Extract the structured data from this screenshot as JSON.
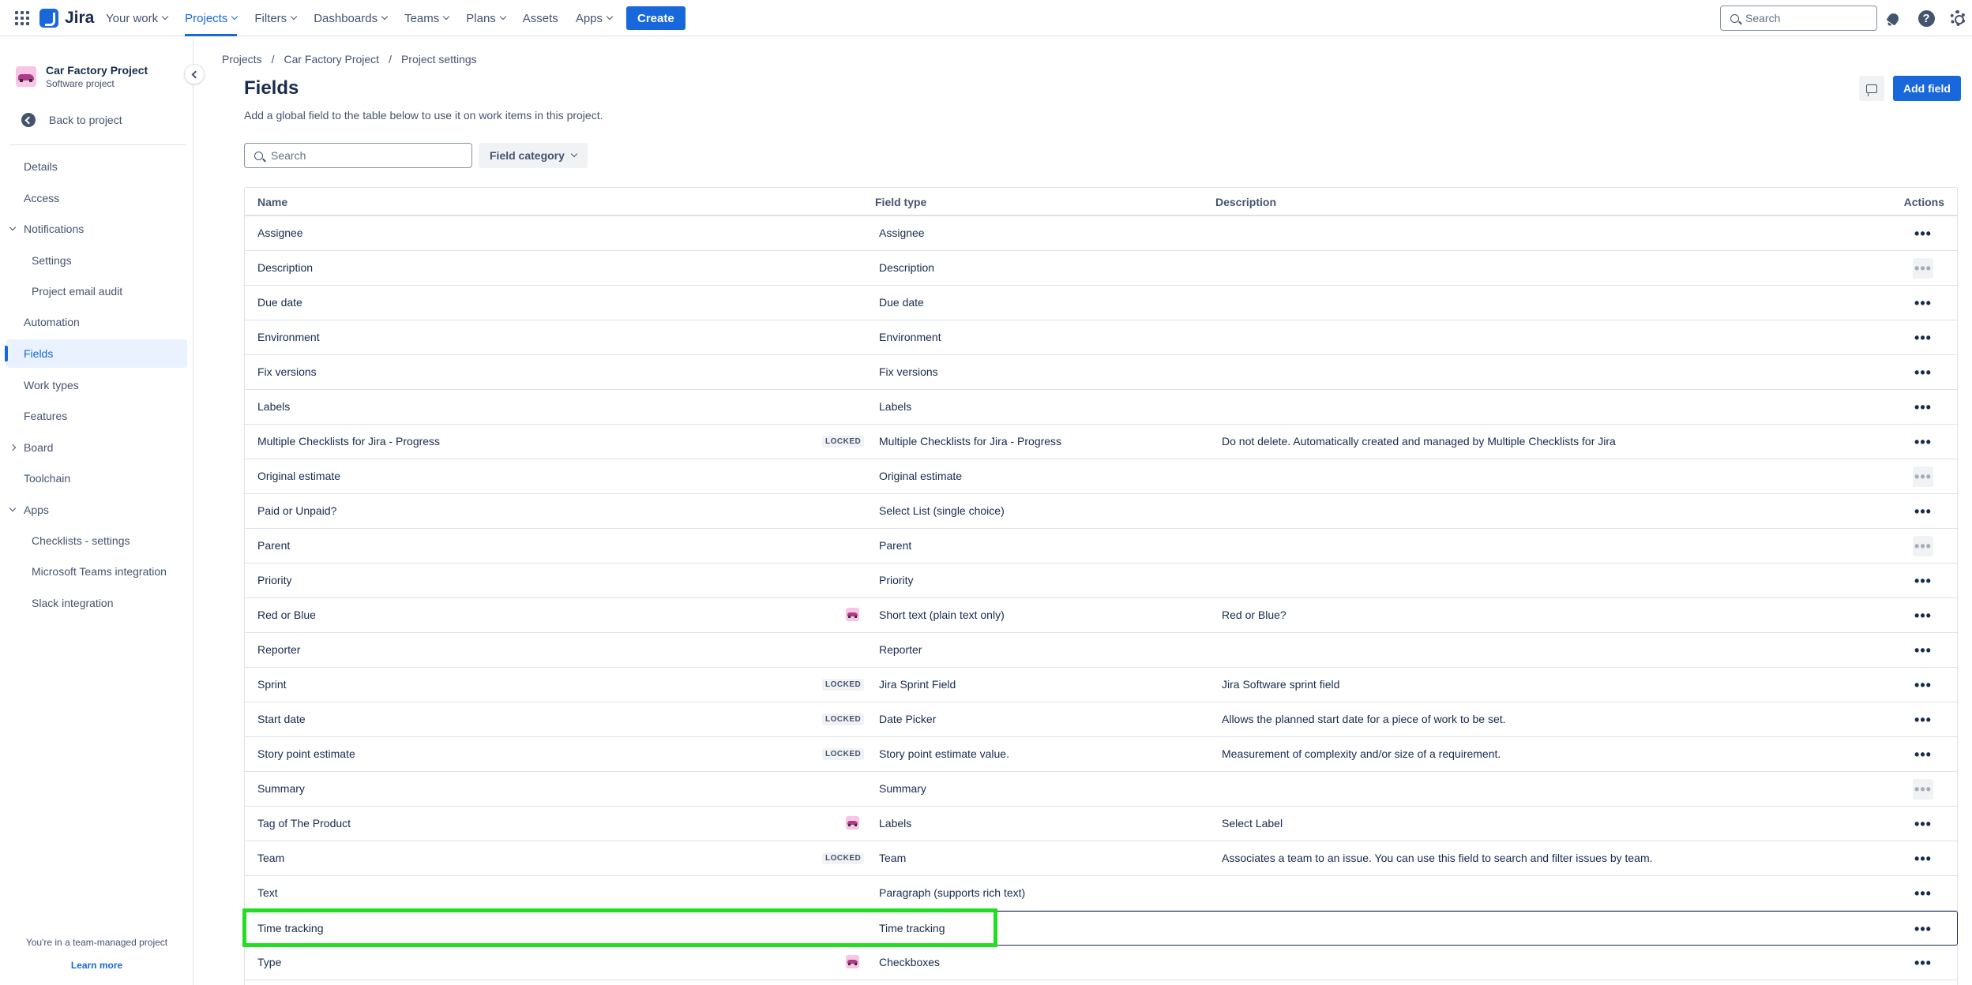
{
  "topnav": {
    "app_name": "Jira",
    "items": [
      {
        "label": "Your work",
        "chevron": true,
        "active": false
      },
      {
        "label": "Projects",
        "chevron": true,
        "active": true
      },
      {
        "label": "Filters",
        "chevron": true,
        "active": false
      },
      {
        "label": "Dashboards",
        "chevron": true,
        "active": false
      },
      {
        "label": "Teams",
        "chevron": true,
        "active": false
      },
      {
        "label": "Plans",
        "chevron": true,
        "active": false
      },
      {
        "label": "Assets",
        "chevron": false,
        "active": false
      },
      {
        "label": "Apps",
        "chevron": true,
        "active": false
      }
    ],
    "create_label": "Create",
    "search_placeholder": "Search",
    "help_glyph": "?"
  },
  "sidebar": {
    "project_name": "Car Factory Project",
    "project_type": "Software project",
    "back_label": "Back to project",
    "items": [
      {
        "label": "Details",
        "level": 0,
        "chevron": "",
        "active": false
      },
      {
        "label": "Access",
        "level": 0,
        "chevron": "",
        "active": false
      },
      {
        "label": "Notifications",
        "level": 0,
        "chevron": "down",
        "active": false
      },
      {
        "label": "Settings",
        "level": 1,
        "chevron": "",
        "active": false
      },
      {
        "label": "Project email audit",
        "level": 1,
        "chevron": "",
        "active": false
      },
      {
        "label": "Automation",
        "level": 0,
        "chevron": "",
        "active": false
      },
      {
        "label": "Fields",
        "level": 0,
        "chevron": "",
        "active": true
      },
      {
        "label": "Work types",
        "level": 0,
        "chevron": "",
        "active": false
      },
      {
        "label": "Features",
        "level": 0,
        "chevron": "",
        "active": false
      },
      {
        "label": "Board",
        "level": 0,
        "chevron": "right",
        "active": false
      },
      {
        "label": "Toolchain",
        "level": 0,
        "chevron": "",
        "active": false
      },
      {
        "label": "Apps",
        "level": 0,
        "chevron": "down",
        "active": false
      },
      {
        "label": "Checklists - settings",
        "level": 1,
        "chevron": "",
        "active": false
      },
      {
        "label": "Microsoft Teams integration",
        "level": 1,
        "chevron": "",
        "active": false
      },
      {
        "label": "Slack integration",
        "level": 1,
        "chevron": "",
        "active": false
      }
    ],
    "footer_text": "You're in a team-managed project",
    "footer_link": "Learn more"
  },
  "breadcrumb": [
    "Projects",
    "Car Factory Project",
    "Project settings"
  ],
  "page": {
    "title": "Fields",
    "description": "Add a global field to the table below to use it on work items in this project.",
    "add_field_label": "Add field",
    "search_placeholder": "Search",
    "category_label": "Field category"
  },
  "table": {
    "columns": {
      "name": "Name",
      "type": "Field type",
      "description": "Description",
      "actions": "Actions"
    },
    "locked_label": "LOCKED",
    "more_glyph": "•••",
    "rows": [
      {
        "name": "Assignee",
        "type": "Assignee",
        "description": "",
        "badge": "",
        "actions_enabled": true
      },
      {
        "name": "Description",
        "type": "Description",
        "description": "",
        "badge": "",
        "actions_enabled": false
      },
      {
        "name": "Due date",
        "type": "Due date",
        "description": "",
        "badge": "",
        "actions_enabled": true
      },
      {
        "name": "Environment",
        "type": "Environment",
        "description": "",
        "badge": "",
        "actions_enabled": true
      },
      {
        "name": "Fix versions",
        "type": "Fix versions",
        "description": "",
        "badge": "",
        "actions_enabled": true
      },
      {
        "name": "Labels",
        "type": "Labels",
        "description": "",
        "badge": "",
        "actions_enabled": true
      },
      {
        "name": "Multiple Checklists for Jira - Progress",
        "type": "Multiple Checklists for Jira - Progress",
        "description": "Do not delete. Automatically created and managed by Multiple Checklists for Jira",
        "badge": "locked",
        "actions_enabled": true
      },
      {
        "name": "Original estimate",
        "type": "Original estimate",
        "description": "",
        "badge": "",
        "actions_enabled": false
      },
      {
        "name": "Paid or Unpaid?",
        "type": "Select List (single choice)",
        "description": "",
        "badge": "",
        "actions_enabled": true
      },
      {
        "name": "Parent",
        "type": "Parent",
        "description": "",
        "badge": "",
        "actions_enabled": false
      },
      {
        "name": "Priority",
        "type": "Priority",
        "description": "",
        "badge": "",
        "actions_enabled": true
      },
      {
        "name": "Red or Blue",
        "type": "Short text (plain text only)",
        "description": "Red or Blue?",
        "badge": "project",
        "actions_enabled": true
      },
      {
        "name": "Reporter",
        "type": "Reporter",
        "description": "",
        "badge": "",
        "actions_enabled": true
      },
      {
        "name": "Sprint",
        "type": "Jira Sprint Field",
        "description": "Jira Software sprint field",
        "badge": "locked",
        "actions_enabled": true
      },
      {
        "name": "Start date",
        "type": "Date Picker",
        "description": "Allows the planned start date for a piece of work to be set.",
        "badge": "locked",
        "actions_enabled": true
      },
      {
        "name": "Story point estimate",
        "type": "Story point estimate value.",
        "description": "Measurement of complexity and/or size of a requirement.",
        "badge": "locked",
        "actions_enabled": true
      },
      {
        "name": "Summary",
        "type": "Summary",
        "description": "",
        "badge": "",
        "actions_enabled": false
      },
      {
        "name": "Tag of The Product",
        "type": "Labels",
        "description": "Select Label",
        "badge": "project",
        "actions_enabled": true
      },
      {
        "name": "Team",
        "type": "Team",
        "description": "Associates a team to an issue. You can use this field to search and filter issues by team.",
        "badge": "locked",
        "actions_enabled": true
      },
      {
        "name": "Text",
        "type": "Paragraph (supports rich text)",
        "description": "",
        "badge": "",
        "actions_enabled": true
      },
      {
        "name": "Time tracking",
        "type": "Time tracking",
        "description": "",
        "badge": "",
        "actions_enabled": true,
        "selected": true
      },
      {
        "name": "Type",
        "type": "Checkboxes",
        "description": "",
        "badge": "project",
        "actions_enabled": true
      }
    ]
  },
  "colors": {
    "accent": "#1868db",
    "highlight": "#22dd22",
    "text": "#172b4d",
    "subtle": "#44546f"
  }
}
